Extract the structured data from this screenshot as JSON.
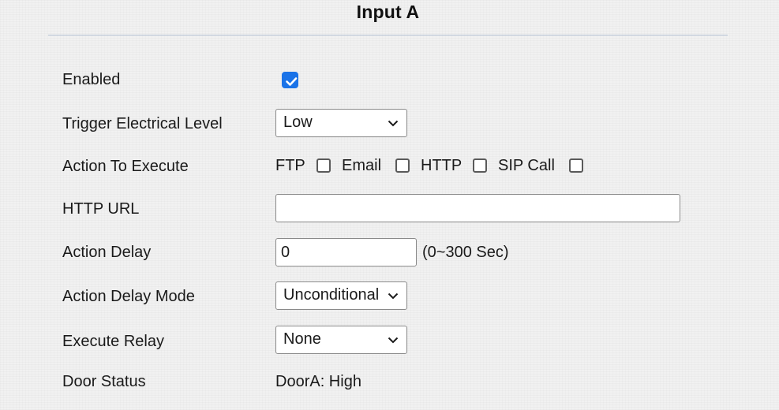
{
  "page": {
    "title": "Input A"
  },
  "form": {
    "enabled": {
      "label": "Enabled",
      "checked": true
    },
    "trigger_level": {
      "label": "Trigger Electrical Level",
      "value": "Low"
    },
    "action_to_execute": {
      "label": "Action To Execute",
      "options": [
        {
          "label": "FTP",
          "checked": false
        },
        {
          "label": "Email",
          "checked": false
        },
        {
          "label": "HTTP",
          "checked": false
        },
        {
          "label": "SIP Call",
          "checked": false
        }
      ]
    },
    "http_url": {
      "label": "HTTP URL",
      "value": ""
    },
    "action_delay": {
      "label": "Action Delay",
      "value": "0",
      "hint": "(0~300 Sec)"
    },
    "action_delay_mode": {
      "label": "Action Delay Mode",
      "value": "Unconditional"
    },
    "execute_relay": {
      "label": "Execute Relay",
      "value": "None"
    },
    "door_status": {
      "label": "Door Status",
      "value": "DoorA: High"
    }
  },
  "colors": {
    "accent": "#1a73e8",
    "divider": "#b6c3d6",
    "background": "#f1f1f1"
  },
  "icons": {
    "checkmark": "check-icon",
    "dropdown": "chevron-down-icon"
  }
}
